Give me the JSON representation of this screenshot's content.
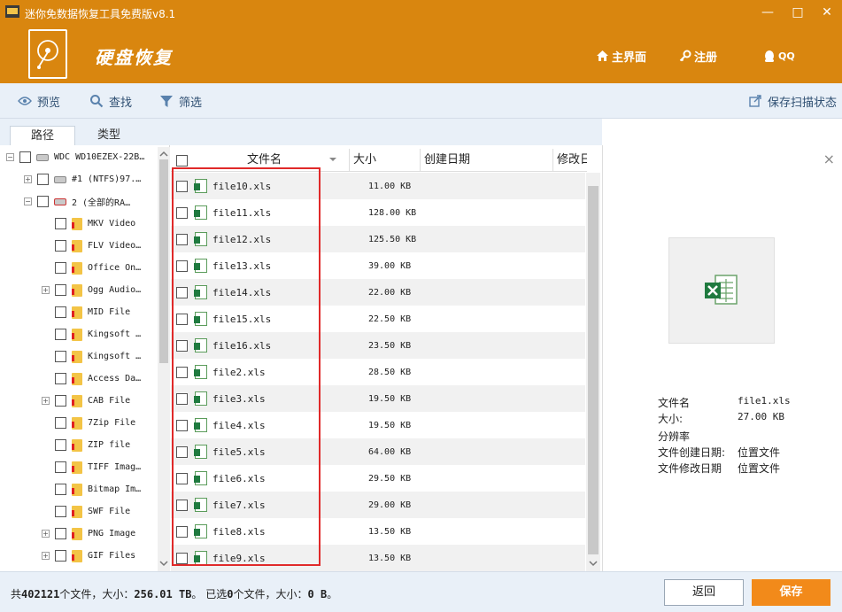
{
  "window": {
    "title": "迷你免数据恢复工具免费版v8.1",
    "app_name": "硬盘恢复",
    "controls": {
      "minimize": "—",
      "maximize": "□",
      "close": "✕"
    }
  },
  "nav": {
    "home": "主界面",
    "register": "注册",
    "qq": "QQ"
  },
  "toolbar": {
    "preview": "预览",
    "search": "查找",
    "filter": "筛选",
    "save_scan": "保存扫描状态"
  },
  "tabs": [
    "路径",
    "类型"
  ],
  "tree": [
    "WDC WD10EZEX-22B…",
    "#1 (NTFS)97.…",
    "2 (全部的RA…",
    "MKV Video",
    "FLV Video…",
    "Office On…",
    "Ogg Audio…",
    "MID File",
    "Kingsoft …",
    "Kingsoft …",
    "Access Da…",
    "CAB File",
    "7Zip File",
    "ZIP file",
    "TIFF Imag…",
    "Bitmap Im…",
    "SWF File",
    "PNG Image",
    "GIF Files"
  ],
  "columns": [
    "文件名",
    "大小",
    "创建日期",
    "修改日"
  ],
  "files": [
    {
      "name": "file10.xls",
      "size": "11.00 KB"
    },
    {
      "name": "file11.xls",
      "size": "128.00 KB"
    },
    {
      "name": "file12.xls",
      "size": "125.50 KB"
    },
    {
      "name": "file13.xls",
      "size": "39.00 KB"
    },
    {
      "name": "file14.xls",
      "size": "22.00 KB"
    },
    {
      "name": "file15.xls",
      "size": "22.50 KB"
    },
    {
      "name": "file16.xls",
      "size": "23.50 KB"
    },
    {
      "name": "file2.xls",
      "size": "28.50 KB"
    },
    {
      "name": "file3.xls",
      "size": "19.50 KB"
    },
    {
      "name": "file4.xls",
      "size": "19.50 KB"
    },
    {
      "name": "file5.xls",
      "size": "64.00 KB"
    },
    {
      "name": "file6.xls",
      "size": "29.50 KB"
    },
    {
      "name": "file7.xls",
      "size": "29.00 KB"
    },
    {
      "name": "file8.xls",
      "size": "13.50 KB"
    },
    {
      "name": "file9.xls",
      "size": "13.50 KB"
    }
  ],
  "preview": {
    "close": "×",
    "labels": {
      "filename": "文件名",
      "size": "大小:",
      "resolution": "分辨率",
      "created": "文件创建日期:",
      "modified": "文件修改日期"
    },
    "values": {
      "filename": "file1.xls",
      "size": "27.00 KB",
      "created": "位置文件",
      "modified": "位置文件"
    }
  },
  "status": {
    "prefix": "共",
    "total_files": "402121",
    "files_suffix": "个文件，大小：",
    "total_size": "256.01 TB",
    "selected_prefix": "。 已选",
    "selected_count": "0",
    "selected_suffix": "个文件，大小：",
    "selected_size": "0 B",
    "end": "。"
  },
  "buttons": {
    "back": "返回",
    "save": "保存"
  }
}
